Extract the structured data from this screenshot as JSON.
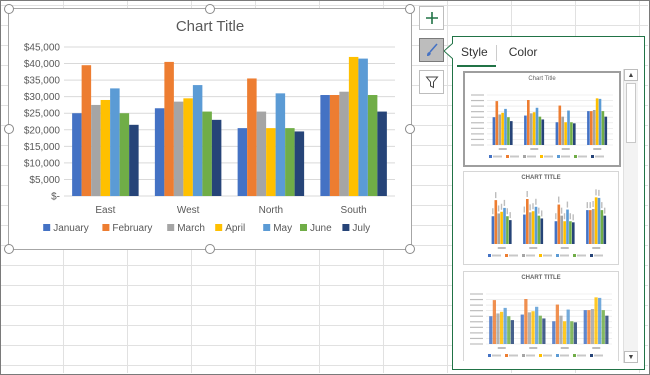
{
  "chart_data": {
    "type": "bar",
    "title": "Chart Title",
    "categories": [
      "East",
      "West",
      "North",
      "South"
    ],
    "y_ticks": [
      "$-",
      "$5,000",
      "$10,000",
      "$15,000",
      "$20,000",
      "$25,000",
      "$30,000",
      "$35,000",
      "$40,000",
      "$45,000"
    ],
    "ylim": [
      0,
      45000
    ],
    "grid": true,
    "legend_position": "bottom",
    "series": [
      {
        "name": "January",
        "color": "#4472C4",
        "values": [
          25000,
          26500,
          20500,
          30500
        ]
      },
      {
        "name": "February",
        "color": "#ED7D31",
        "values": [
          39500,
          40500,
          35500,
          30500
        ]
      },
      {
        "name": "March",
        "color": "#A5A5A5",
        "values": [
          27500,
          28500,
          25500,
          31500
        ]
      },
      {
        "name": "April",
        "color": "#FFC000",
        "values": [
          29000,
          29500,
          20500,
          42000
        ]
      },
      {
        "name": "May",
        "color": "#5B9BD5",
        "values": [
          32500,
          33500,
          31000,
          41500
        ]
      },
      {
        "name": "June",
        "color": "#70AD47",
        "values": [
          25000,
          25500,
          20500,
          30500
        ]
      },
      {
        "name": "July",
        "color": "#264478",
        "values": [
          21500,
          23000,
          19500,
          25500
        ]
      }
    ]
  },
  "side_buttons": {
    "chart_elements": "plus-icon",
    "chart_styles": "brush-icon",
    "chart_filters": "filter-icon"
  },
  "panel": {
    "tabs": [
      {
        "label": "Style",
        "selected": true
      },
      {
        "label": "Color",
        "selected": false
      }
    ],
    "styles": [
      {
        "title": "Chart Title",
        "selected": true
      },
      {
        "title": "CHART TITLE",
        "selected": false
      },
      {
        "title": "CHART TITLE",
        "selected": false
      }
    ]
  },
  "colors": {
    "accent": "#217346"
  }
}
